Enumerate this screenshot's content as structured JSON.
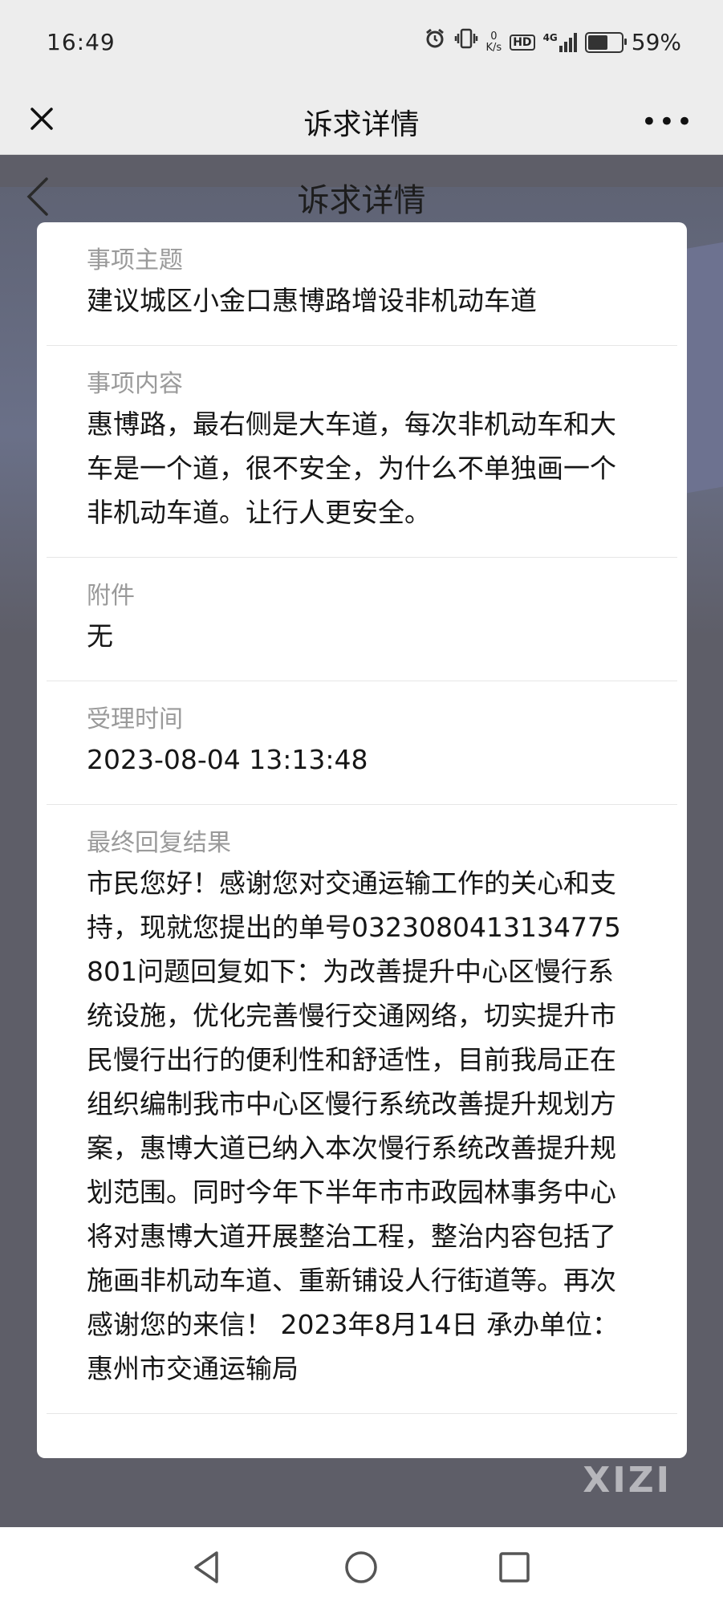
{
  "status_bar": {
    "time": "16:49",
    "net_speed_value": "0",
    "net_speed_unit": "K/s",
    "hd": "HD",
    "network": "4G",
    "battery_percent": "59%",
    "battery_level": 0.59
  },
  "nav": {
    "title": "诉求详情",
    "close_icon": "close-icon",
    "more_icon": "more-icon"
  },
  "inner_header": {
    "title": "诉求详情",
    "back_icon": "chevron-left-icon"
  },
  "sections": [
    {
      "label": "事项主题",
      "value": "建议城区小金口惠博路增设非机动车道"
    },
    {
      "label": "事项内容",
      "value": "惠博路，最右侧是大车道，每次非机动车和大车是一个道，很不安全，为什么不单独画一个非机动车道。让行人更安全。"
    },
    {
      "label": "附件",
      "value": "无"
    },
    {
      "label": "受理时间",
      "value": "2023-08-04 13:13:48"
    },
    {
      "label": "最终回复结果",
      "value": "市民您好！感谢您对交通运输工作的关心和支持，现就您提出的单号0323080413134775801问题回复如下：为改善提升中心区慢行系统设施，优化完善慢行交通网络，切实提升市民慢行出行的便利性和舒适性，目前我局正在组织编制我市中心区慢行系统改善提升规划方案，惠博大道已纳入本次慢行系统改善提升规划范围。同时今年下半年市市政园林事务中心将对惠博大道开展整治工程，整治内容包括了施画非机动车道、重新铺设人行街道等。再次感谢您的来信！ 2023年8月14日 承办单位：惠州市交通运输局"
    }
  ],
  "watermark": "XIZI",
  "bottom_nav": {
    "back_icon": "triangle-back-icon",
    "home_icon": "circle-home-icon",
    "recents_icon": "square-recents-icon"
  }
}
